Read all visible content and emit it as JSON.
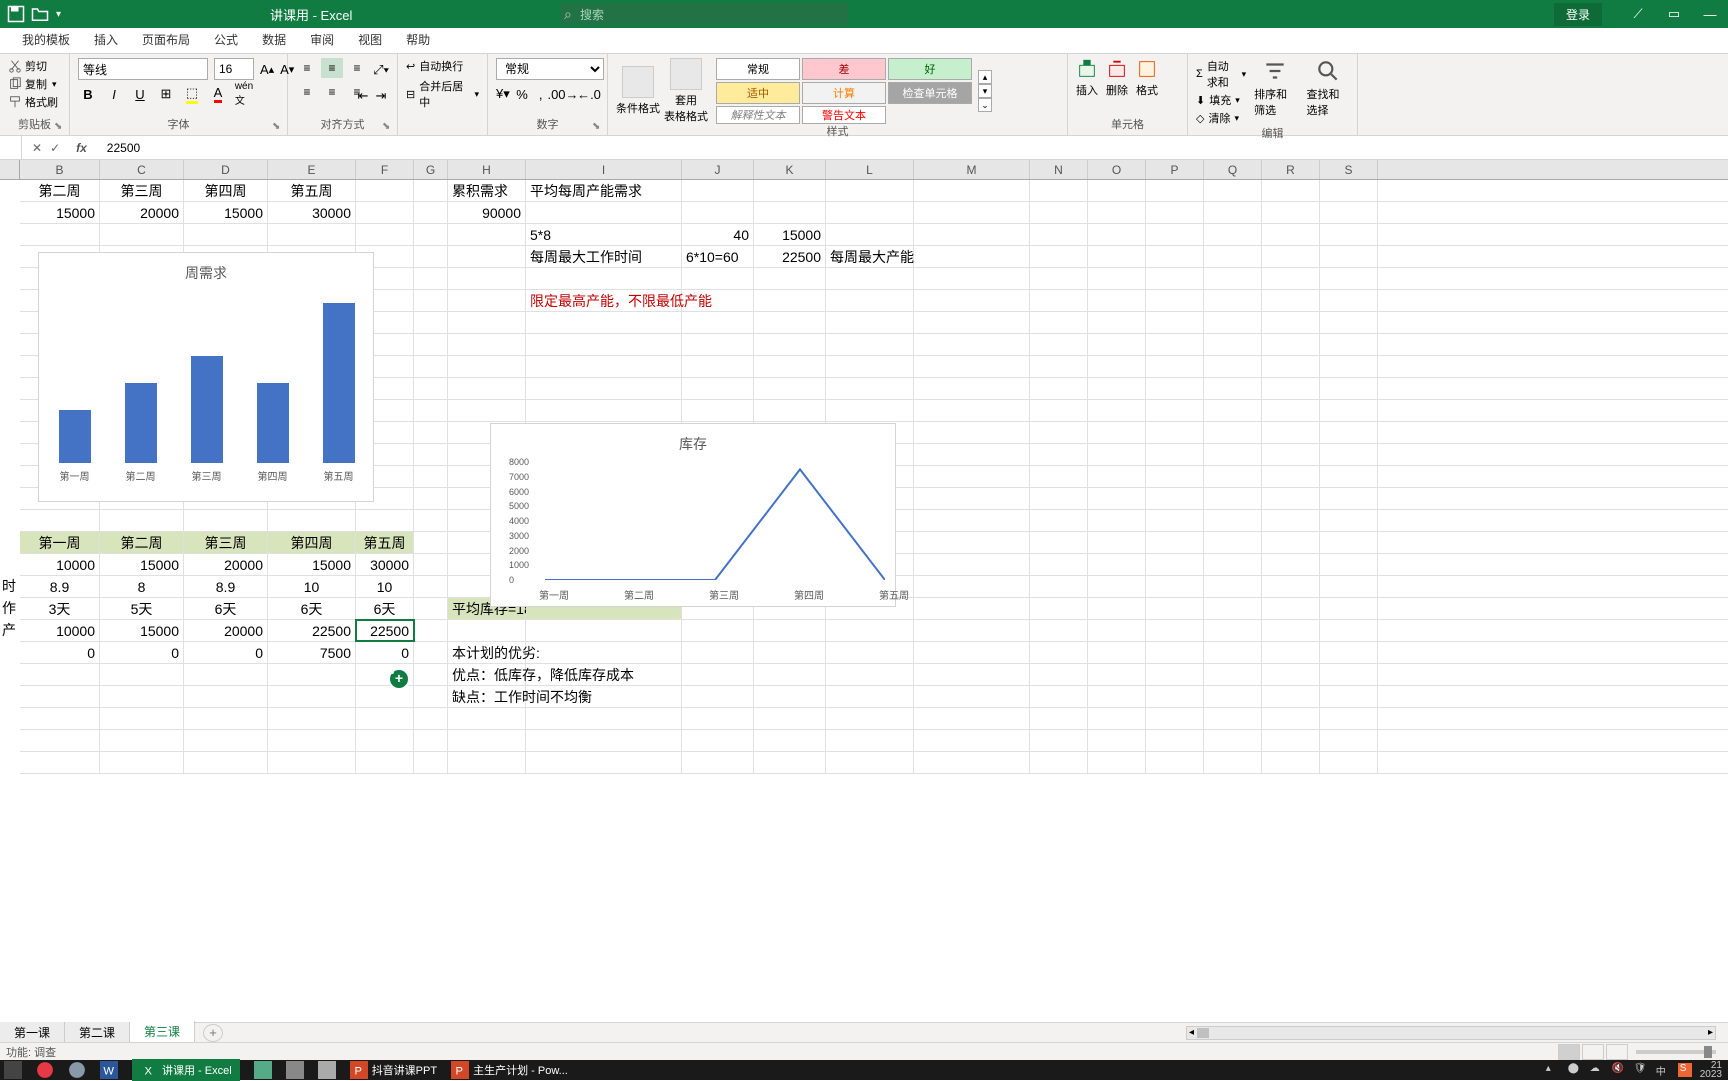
{
  "titlebar": {
    "title": "讲课用 - Excel",
    "search_placeholder": "搜索",
    "login": "登录"
  },
  "ribbon_tabs": [
    "我的模板",
    "插入",
    "页面布局",
    "公式",
    "数据",
    "审阅",
    "视图",
    "帮助"
  ],
  "ribbon": {
    "clipboard": {
      "cut": "剪切",
      "copy": "复制",
      "painter": "格式刷",
      "label": "剪贴板"
    },
    "font": {
      "label": "字体",
      "name": "等线",
      "size": "16"
    },
    "align": {
      "label": "对齐方式"
    },
    "wrap": {
      "wrap": "自动换行",
      "merge": "合并后居中"
    },
    "number": {
      "label": "数字",
      "format": "常规"
    },
    "styles": {
      "label": "样式",
      "cond": "条件格式",
      "table": "套用\n表格格式",
      "cells": [
        "常规",
        "差",
        "好",
        "适中",
        "计算",
        "检查单元格",
        "解释性文本",
        "警告文本"
      ]
    },
    "cells_group": {
      "label": "单元格",
      "insert": "插入",
      "delete": "删除",
      "format": "格式"
    },
    "edit": {
      "label": "编辑",
      "sum": "自动求和",
      "fill": "填充",
      "clear": "清除",
      "sort": "排序和筛选",
      "find": "查找和选择"
    }
  },
  "formula_bar": {
    "value": "22500"
  },
  "columns": [
    "B",
    "C",
    "D",
    "E",
    "F",
    "G",
    "H",
    "I",
    "J",
    "K",
    "L",
    "M",
    "N",
    "O",
    "P",
    "Q",
    "R",
    "S"
  ],
  "sheet": {
    "headers_row1": {
      "B": "第二周",
      "C": "第三周",
      "D": "第四周",
      "E": "第五周",
      "H": "累积需求",
      "I": "平均每周产能需求"
    },
    "row2": {
      "B": "15000",
      "C": "20000",
      "D": "15000",
      "E": "30000",
      "H": "90000"
    },
    "row3": {
      "I": "5*8",
      "J": "40",
      "K": "15000"
    },
    "row4": {
      "I": "每周最大工作时间",
      "J": "6*10=60",
      "K": "22500",
      "L": "每周最大产能"
    },
    "row6": {
      "I": "限定最高产能，不限最低产能"
    },
    "table_header": {
      "B": "第一周",
      "C": "第二周",
      "D": "第三周",
      "E": "第四周",
      "F": "第五周"
    },
    "tr1": {
      "B": "10000",
      "C": "15000",
      "D": "20000",
      "E": "15000",
      "F": "30000"
    },
    "tr2": {
      "A": "时",
      "B": "8.9",
      "C": "8",
      "D": "8.9",
      "E": "10",
      "F": "10"
    },
    "tr3": {
      "A": "作",
      "B": "3天",
      "C": "5天",
      "D": "6天",
      "E": "6天",
      "F": "6天"
    },
    "tr4": {
      "A": "产",
      "B": "10000",
      "C": "15000",
      "D": "20000",
      "E": "22500",
      "F": "22500"
    },
    "tr5": {
      "B": "0",
      "C": "0",
      "D": "0",
      "E": "7500",
      "F": "0"
    },
    "avg_inv": "平均库存=1875",
    "plan_title": "本计划的优劣:",
    "plan_adv": "优点：低库存，降低库存成本",
    "plan_dis": "缺点：工作时间不均衡"
  },
  "chart_data": [
    {
      "type": "bar",
      "title": "周需求",
      "categories": [
        "第一周",
        "第二周",
        "第三周",
        "第四周",
        "第五周"
      ],
      "values": [
        10000,
        15000,
        20000,
        15000,
        30000
      ],
      "ylim": [
        0,
        30000
      ]
    },
    {
      "type": "line",
      "title": "库存",
      "categories": [
        "第一周",
        "第二周",
        "第三周",
        "第四周",
        "第五周"
      ],
      "values": [
        0,
        0,
        0,
        7500,
        0
      ],
      "ylim": [
        0,
        8000
      ],
      "yticks": [
        0,
        1000,
        2000,
        3000,
        4000,
        5000,
        6000,
        7000,
        8000
      ]
    }
  ],
  "sheet_tabs": [
    "第一课",
    "第二课",
    "第三课"
  ],
  "active_sheet": 2,
  "status_bar": {
    "mode": "功能: 调查"
  },
  "taskbar": {
    "excel": "讲课用 - Excel",
    "ppt1": "抖音讲课PPT",
    "ppt2": "主生产计划 - Pow...",
    "time": "21",
    "date": "2023"
  }
}
